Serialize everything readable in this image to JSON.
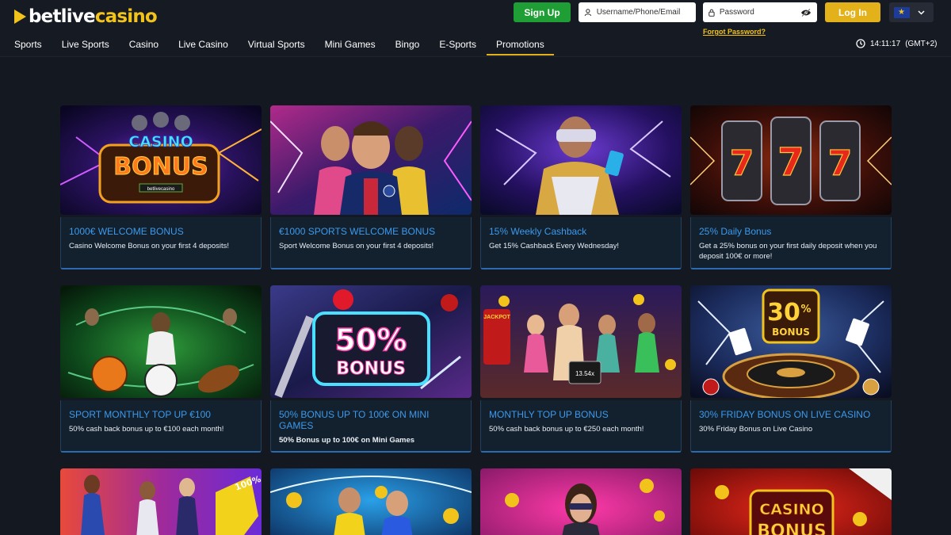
{
  "brand": {
    "part1": "betlive",
    "part2": "casino"
  },
  "auth": {
    "signup_label": "Sign Up",
    "username_placeholder": "Username/Phone/Email",
    "password_placeholder": "Password",
    "forgot_label": "Forgot Password?",
    "login_label": "Log In"
  },
  "nav": [
    "Sports",
    "Live Sports",
    "Casino",
    "Live Casino",
    "Virtual Sports",
    "Mini Games",
    "Bingo",
    "E-Sports",
    "Promotions"
  ],
  "nav_active": "Promotions",
  "clock": {
    "time": "14:11:17",
    "tz": "(GMT+2)"
  },
  "promotions": [
    {
      "title": "1000€ WELCOME BONUS",
      "desc": "Casino Welcome Bonus on your first 4 deposits!",
      "art": "casino-bonus",
      "art_text": [
        "CASINO",
        "BONUS"
      ],
      "art_badge": "betlivecasino"
    },
    {
      "title": "€1000 SPORTS WELCOME BONUS",
      "desc": "Sport Welcome Bonus on your first 4 deposits!",
      "art": "footballers"
    },
    {
      "title": "15% Weekly Cashback",
      "desc": "Get 15% Cashback Every Wednesday!",
      "art": "vr-player"
    },
    {
      "title": "25% Daily Bonus",
      "desc": "Get a 25% bonus on your first daily deposit when you deposit 100€ or more!",
      "art": "slot-777"
    },
    {
      "title": "SPORT MONTHLY TOP UP €100",
      "desc": "50% cash back bonus up to €100 each month!",
      "art": "sports-balls"
    },
    {
      "title": "50% BONUS UP TO 100€ ON MINI GAMES",
      "desc": "50% Bonus up to 100€ on Mini Games",
      "art": "50-bonus",
      "art_text": [
        "50%",
        "BONUS"
      ],
      "desc_bold": true
    },
    {
      "title": "MONTHLY TOP UP BONUS",
      "desc": "50% cash back bonus up to €250 each month!",
      "art": "slot-characters",
      "art_badge": "JACKPOT",
      "art_multiplier": "13.54x"
    },
    {
      "title": "30% FRIDAY BONUS ON LIVE CASINO",
      "desc": "30% Friday Bonus on Live Casino",
      "art": "roulette",
      "art_text": [
        "30",
        "%",
        "BONUS"
      ]
    }
  ],
  "promotions_row3": [
    {
      "art": "athletes",
      "art_text": [
        "100%"
      ]
    },
    {
      "art": "soccer-stars"
    },
    {
      "art": "woman-pink"
    },
    {
      "art": "casino-bonus-red",
      "art_text": [
        "CASINO",
        "BONUS"
      ]
    }
  ],
  "colors": {
    "accent": "#e3b21a",
    "signup": "#1e9e34",
    "link": "#3b9aed",
    "bg": "#141821"
  }
}
